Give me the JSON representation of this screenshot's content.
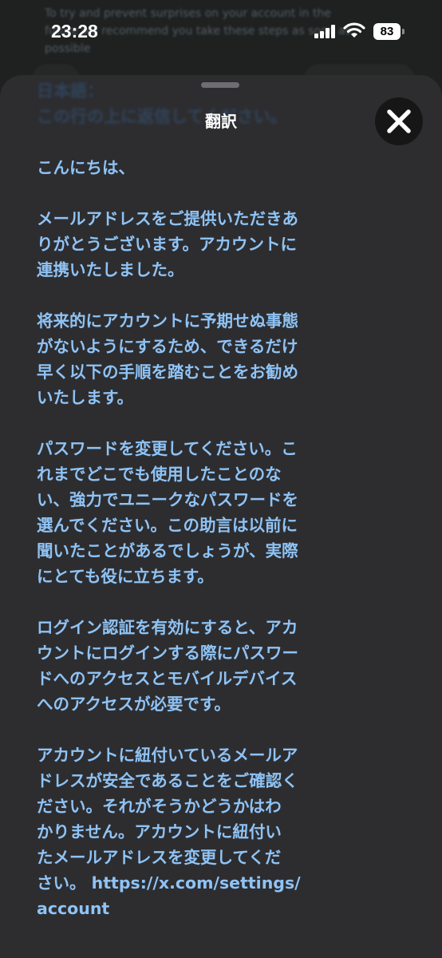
{
  "background": {
    "en_line1": "To try and prevent surprises on your account in the",
    "en_line2": "future we recommend you take these steps as soon as",
    "en_line3": "possible",
    "ja_line1": "日本語：",
    "ja_line2": "この行の上に返信してください。"
  },
  "status_bar": {
    "time": "23:28",
    "battery": "83"
  },
  "sheet": {
    "title": "翻訳",
    "paragraphs": [
      "こんにちは、",
      "メールアドレスをご提供いただきあ\nりがとうございます。アカウントに\n連携いたしました。",
      "将来的にアカウントに予期せぬ事態\nがないようにするため、できるだけ\n早く以下の手順を踏むことをお勧め\nいたします。",
      "パスワードを変更してください。こ\nれまでどこでも使用したことのな\nい、強力でユニークなパスワードを\n選んでください。この助言は以前に\n聞いたことがあるでしょうが、実際\nにとても役に立ちます。",
      "ログイン認証を有効にすると、アカ\nウントにログインする際にパスワー\nドへのアクセスとモバイルデバイス\nへのアクセスが必要です。"
    ],
    "last_paragraph": "アカウントに紐付いているメールア\nドレスが安全であることをご確認く\nださい。それがそうかどうかはわ\nかりません。アカウントに紐付い\nたメールアドレスを変更してくだ\nさい。 ",
    "url_line1": "https://x.com/settings/",
    "url_line2": "account"
  },
  "colors": {
    "sheet_bg": "#2d2d30",
    "text_blue": "#8fc3f5",
    "close_bg": "#161617"
  }
}
